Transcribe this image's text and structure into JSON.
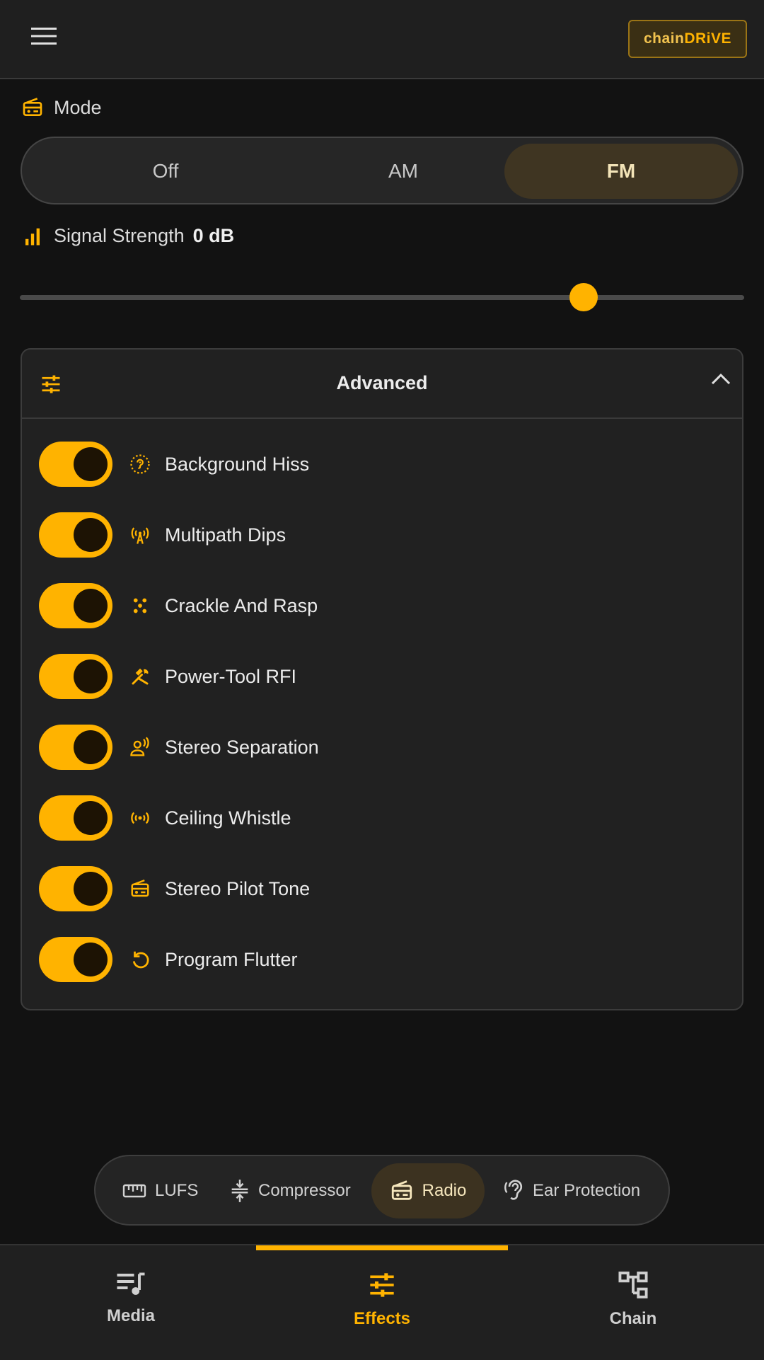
{
  "header": {
    "menu_icon": "hamburger-icon",
    "logo_part1": "chain",
    "logo_part2": "DRiVE"
  },
  "mode": {
    "label": "Mode",
    "icon": "radio-icon",
    "options": [
      "Off",
      "AM",
      "FM"
    ],
    "selected": "FM"
  },
  "signal": {
    "label": "Signal Strength",
    "value": "0 dB",
    "icon": "signal-bars-icon",
    "slider_fraction": 0.79
  },
  "advanced": {
    "title": "Advanced",
    "icon": "tune-icon",
    "expanded": true,
    "toggles": [
      {
        "label": "Background Hiss",
        "icon": "hiss-icon",
        "on": true
      },
      {
        "label": "Multipath Dips",
        "icon": "antenna-icon",
        "on": true
      },
      {
        "label": "Crackle And Rasp",
        "icon": "dots-icon",
        "on": true
      },
      {
        "label": "Power-Tool RFI",
        "icon": "tools-icon",
        "on": true
      },
      {
        "label": "Stereo Separation",
        "icon": "voice-icon",
        "on": true
      },
      {
        "label": "Ceiling Whistle",
        "icon": "broadcast-icon",
        "on": true
      },
      {
        "label": "Stereo Pilot Tone",
        "icon": "radio-icon",
        "on": true
      },
      {
        "label": "Program Flutter",
        "icon": "rotate-icon",
        "on": true
      }
    ]
  },
  "effects_tabs": [
    {
      "label": "LUFS",
      "icon": "ruler-icon"
    },
    {
      "label": "Compressor",
      "icon": "compress-icon"
    },
    {
      "label": "Radio",
      "icon": "radio-icon",
      "active": true
    },
    {
      "label": "Ear Protection",
      "icon": "ear-icon"
    }
  ],
  "bottom_nav": [
    {
      "label": "Media",
      "icon": "queue-music-icon"
    },
    {
      "label": "Effects",
      "icon": "tune-icon",
      "active": true
    },
    {
      "label": "Chain",
      "icon": "chain-tree-icon"
    }
  ],
  "colors": {
    "accent": "#ffb300",
    "background": "#121212",
    "surface": "#212121"
  }
}
